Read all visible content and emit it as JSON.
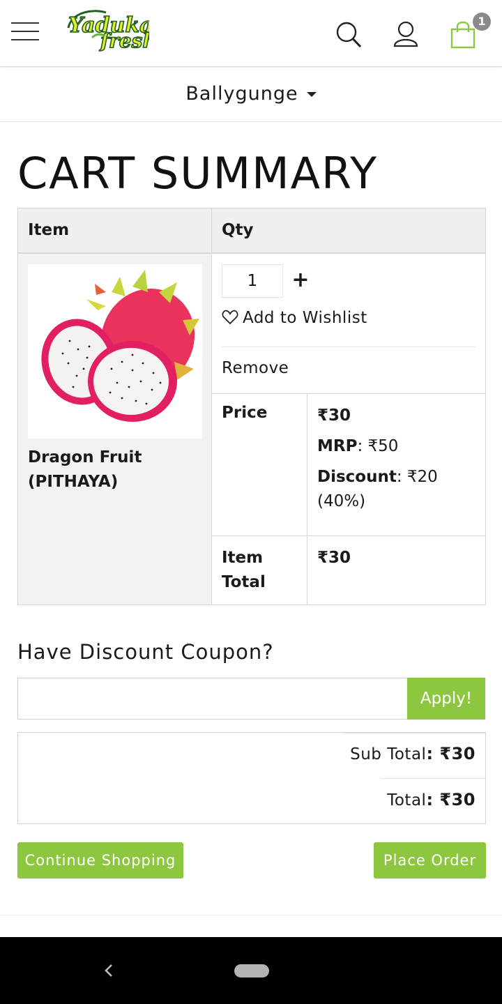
{
  "header": {
    "logo_text_top": "Yaduka",
    "logo_text_bottom": "fresh",
    "cart_count": "1",
    "icons": [
      "hamburger-menu-icon",
      "search-icon",
      "user-icon",
      "shopping-bag-icon"
    ]
  },
  "location": {
    "selected": "Ballygunge"
  },
  "page": {
    "title": "CART SUMMARY"
  },
  "cart": {
    "columns": [
      "Item",
      "Qty"
    ],
    "items": [
      {
        "name": "Dragon Fruit (PITHAYA)",
        "quantity": "1",
        "plus_label": "+",
        "wishlist_label": "Add to Wishlist",
        "remove_label": "Remove",
        "price_label": "Price",
        "price": "₹30",
        "mrp_label": "MRP",
        "mrp": ": ₹50",
        "discount_label": "Discount",
        "discount": ": ₹20 (40%)",
        "item_total_label": "Item Total",
        "item_total": "₹30"
      }
    ]
  },
  "coupon": {
    "title": "Have Discount Coupon?",
    "input_value": "",
    "apply_label": "Apply!"
  },
  "totals": {
    "subtotal_label": "Sub Total",
    "subtotal": ": ₹30",
    "total_label": "Total",
    "total": ": ₹30"
  },
  "actions": {
    "continue_label": "Continue Shopping",
    "place_order_label": "Place Order"
  },
  "colors": {
    "accent_green": "#8dc63f",
    "badge_grey": "#8a8a8a",
    "logo_dark_green": "#1f5e1f",
    "logo_yellow": "#e3ef2b"
  }
}
